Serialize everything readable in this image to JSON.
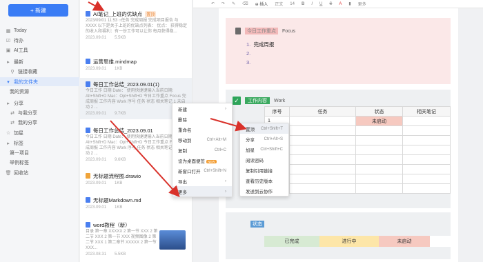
{
  "sidebar": {
    "new_button": "+ 新建",
    "items": [
      {
        "label": "Today",
        "icon": "calendar-icon"
      },
      {
        "label": "待办",
        "icon": "todo-icon"
      },
      {
        "label": "AI工具",
        "icon": "ai-icon"
      },
      {
        "label": "最新",
        "icon": "caret-icon"
      },
      {
        "label": "链接收藏",
        "icon": "link-icon"
      },
      {
        "label": "我的文件夹",
        "icon": "folder-icon"
      },
      {
        "label": "我的资源",
        "icon": ""
      },
      {
        "label": "分享",
        "icon": "caret-icon"
      },
      {
        "label": "与我分享",
        "icon": "share-icon"
      },
      {
        "label": "我的分享",
        "icon": "share-icon"
      },
      {
        "label": "加星",
        "icon": "star-icon"
      },
      {
        "label": "标签",
        "icon": "caret-icon"
      },
      {
        "label": "第一项目",
        "icon": ""
      },
      {
        "label": "举例标签",
        "icon": ""
      },
      {
        "label": "回收站",
        "icon": "trash-icon"
      }
    ]
  },
  "files": [
    {
      "title": "AI笔记_上班的优缺点",
      "tag": "置顶",
      "desc": "2023/09/01 11:53 ○任务 完成周报 完成项目报告 与XXXX 以下是关于上班的优缺点列表： 优点： 获得稳定的收入和福利：有一份工作可以让你 每月获得稳...",
      "date": "2023.09.01",
      "size": "5.5KB"
    },
    {
      "title": "运营思维.mindmap",
      "desc": "",
      "date": "2023.09.01",
      "size": "1KB"
    },
    {
      "title": "每日工作总结_2023.09.01(1)",
      "desc": "今日工作 日期 Date： 使用快捷键输入当前日期: Alt+Shift+D Mac：Opt+Shift+D 今日工作重点 Focus 完成周报 工作内容 Work 序号 任务 状态 相关笔记 1 未启动 2 ...",
      "date": "2023.09.01",
      "size": "9.7KB"
    },
    {
      "title": "每日工作总结_2023.09.01",
      "desc": "今日工作 日期 Date： 使用快捷键输入当前日期: Alt+Shift+D Mac：Opt+Shift+D 今日工作重点 Focus 完成周报 工作内容 Work 序号 任务 状态 相关笔记 1 未启动 2 ...",
      "date": "2023.09.01",
      "size": "9.6KB"
    },
    {
      "title": "无标题流程图.drawio",
      "desc": "",
      "date": "2023.09.01",
      "size": "1KB"
    },
    {
      "title": "无标题Markdown.md",
      "desc": "",
      "date": "2023.09.01",
      "size": "1KB"
    },
    {
      "title": "word教程（新）",
      "desc": "目录 第一章 XXXXX 2 第一节 XXX 2 第二节 XXX 2 第一节 XXX 视频图像 2 第二节 XXX 1 第二章节 XXXXX 2 第一节 XXX...",
      "date": "2023.08.31",
      "size": "5.5KB"
    }
  ],
  "toolbar": {
    "insert": "⊕ 插入",
    "style": "正文",
    "size": "14",
    "more": "更多"
  },
  "document": {
    "focus_heading": "今日工作重点",
    "focus_label": "Focus",
    "focus_items": [
      "完成周报",
      "",
      ""
    ],
    "work_heading": "工作内容",
    "work_label": "Work",
    "table_headers": [
      "序号",
      "任务",
      "状态",
      "相关笔记"
    ],
    "row1_num": "1",
    "row1_status": "未启动",
    "summary_label": "状态",
    "summary_cells": [
      "已完成",
      "进行中",
      "未启动"
    ]
  },
  "context_menu": [
    {
      "label": "新建",
      "shortcut": "",
      "submenu": true
    },
    {
      "label": "删除",
      "shortcut": ""
    },
    {
      "label": "重命名",
      "shortcut": ""
    },
    {
      "label": "移动到",
      "shortcut": "Ctrl+Alt+M"
    },
    {
      "label": "复制",
      "shortcut": "Ctrl+C"
    },
    {
      "label": "设为桌面便签",
      "shortcut": "",
      "badge": "NEW"
    },
    {
      "label": "新窗口打开",
      "shortcut": "Ctrl+Shift+N"
    },
    {
      "label": "导出",
      "shortcut": "",
      "submenu": true
    },
    {
      "label": "更多",
      "shortcut": "",
      "submenu": true
    }
  ],
  "submenu": [
    {
      "label": "置顶",
      "shortcut": "Ctrl+Shift+T"
    },
    {
      "label": "分享",
      "shortcut": "Ctrl+Alt+S"
    },
    {
      "label": "加星",
      "shortcut": "Ctrl+Shift+C"
    },
    {
      "label": "阅读密码",
      "shortcut": ""
    },
    {
      "label": "复制引用链接",
      "shortcut": ""
    },
    {
      "label": "查看历史版本",
      "shortcut": ""
    },
    {
      "label": "发送到云协作",
      "shortcut": ""
    }
  ],
  "colors": {
    "accent": "#3a7cf5",
    "arrow": "#d9312a",
    "focus_bg": "#fbe8e8",
    "status_red": "#f6c9c0"
  }
}
